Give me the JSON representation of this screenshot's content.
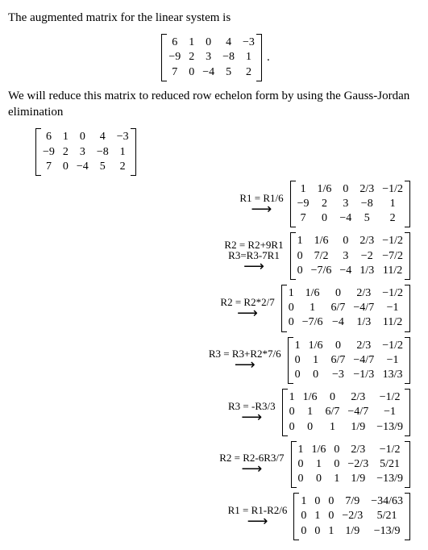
{
  "intro": "The augmented matrix for the linear system is",
  "reduce_text": "We will reduce this matrix to reduced row echelon form by using the Gauss-Jordan elimination",
  "period": ".",
  "matrix0": [
    [
      "6",
      "1",
      "0",
      "4",
      "−3"
    ],
    [
      "−9",
      "2",
      "3",
      "−8",
      "1"
    ],
    [
      "7",
      "0",
      "−4",
      "5",
      "2"
    ]
  ],
  "steps": [
    {
      "op": [
        "R1 = R1/6"
      ],
      "m": [
        [
          "1",
          "1/6",
          "0",
          "2/3",
          "−1/2"
        ],
        [
          "−9",
          "2",
          "3",
          "−8",
          "1"
        ],
        [
          "7",
          "0",
          "−4",
          "5",
          "2"
        ]
      ]
    },
    {
      "op": [
        "R2 = R2+9R1",
        "R3=R3-7R1"
      ],
      "m": [
        [
          "1",
          "1/6",
          "0",
          "2/3",
          "−1/2"
        ],
        [
          "0",
          "7/2",
          "3",
          "−2",
          "−7/2"
        ],
        [
          "0",
          "−7/6",
          "−4",
          "1/3",
          "11/2"
        ]
      ]
    },
    {
      "op": [
        "R2 = R2*2/7"
      ],
      "m": [
        [
          "1",
          "1/6",
          "0",
          "2/3",
          "−1/2"
        ],
        [
          "0",
          "1",
          "6/7",
          "−4/7",
          "−1"
        ],
        [
          "0",
          "−7/6",
          "−4",
          "1/3",
          "11/2"
        ]
      ]
    },
    {
      "op": [
        "R3 = R3+R2*7/6"
      ],
      "m": [
        [
          "1",
          "1/6",
          "0",
          "2/3",
          "−1/2"
        ],
        [
          "0",
          "1",
          "6/7",
          "−4/7",
          "−1"
        ],
        [
          "0",
          "0",
          "−3",
          "−1/3",
          "13/3"
        ]
      ]
    },
    {
      "op": [
        "R3 = -R3/3"
      ],
      "m": [
        [
          "1",
          "1/6",
          "0",
          "2/3",
          "−1/2"
        ],
        [
          "0",
          "1",
          "6/7",
          "−4/7",
          "−1"
        ],
        [
          "0",
          "0",
          "1",
          "1/9",
          "−13/9"
        ]
      ]
    },
    {
      "op": [
        "R2 = R2-6R3/7"
      ],
      "m": [
        [
          "1",
          "1/6",
          "0",
          "2/3",
          "−1/2"
        ],
        [
          "0",
          "1",
          "0",
          "−2/3",
          "5/21"
        ],
        [
          "0",
          "0",
          "1",
          "1/9",
          "−13/9"
        ]
      ]
    },
    {
      "op": [
        "R1 = R1-R2/6"
      ],
      "m": [
        [
          "1",
          "0",
          "0",
          "7/9",
          "−34/63"
        ],
        [
          "0",
          "1",
          "0",
          "−2/3",
          "5/21"
        ],
        [
          "0",
          "0",
          "1",
          "1/9",
          "−13/9"
        ]
      ]
    }
  ]
}
